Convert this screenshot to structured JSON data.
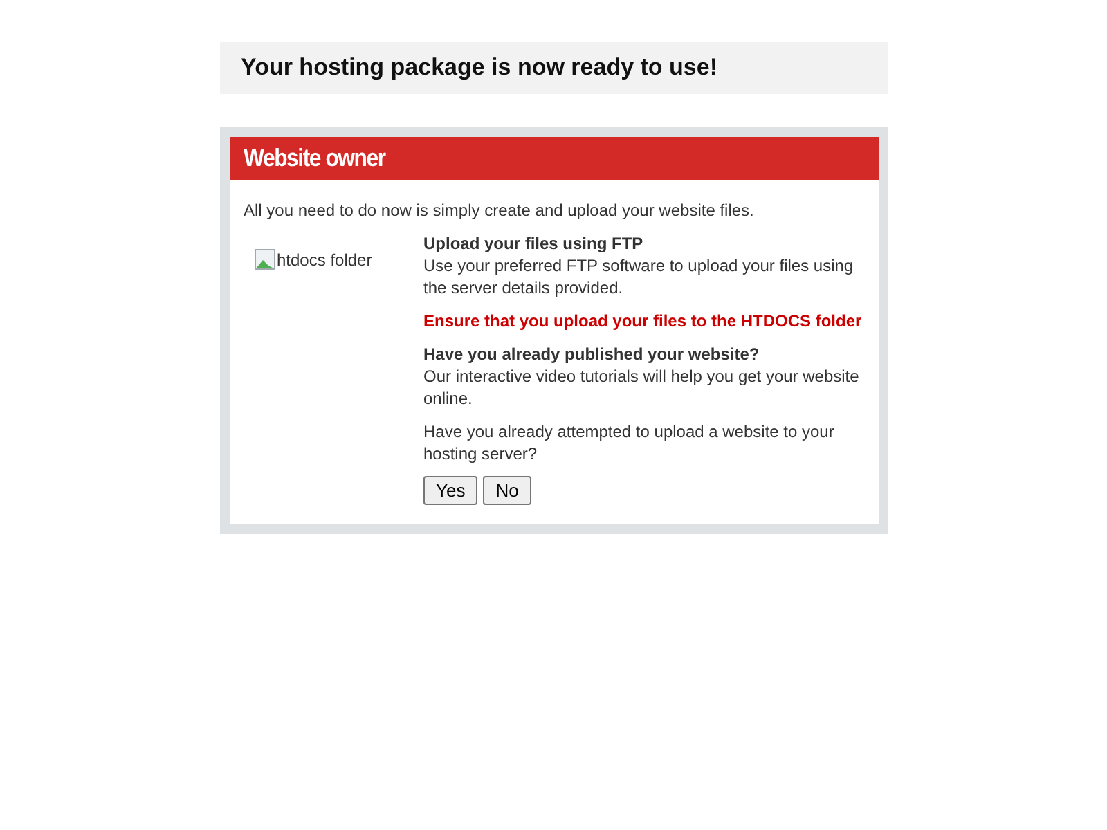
{
  "banner": {
    "title": "Your hosting package is now ready to use!"
  },
  "panel": {
    "title": "Website owner",
    "intro": "All you need to do now is simply create and upload your website files.",
    "image_alt": "htdocs folder",
    "sections": [
      {
        "kind": "info",
        "title": "Upload your files using FTP",
        "body": "Use your preferred FTP software to upload your files using the server details provided."
      },
      {
        "kind": "warning",
        "text": "Ensure that you upload your files to the HTDOCS folder"
      },
      {
        "kind": "info",
        "title": "Have you already published your website?",
        "body": "Our interactive video tutorials will help you get your website online."
      },
      {
        "kind": "question",
        "text": "Have you already attempted to upload a website to your hosting server?"
      }
    ],
    "buttons": [
      "Yes",
      "No"
    ]
  }
}
